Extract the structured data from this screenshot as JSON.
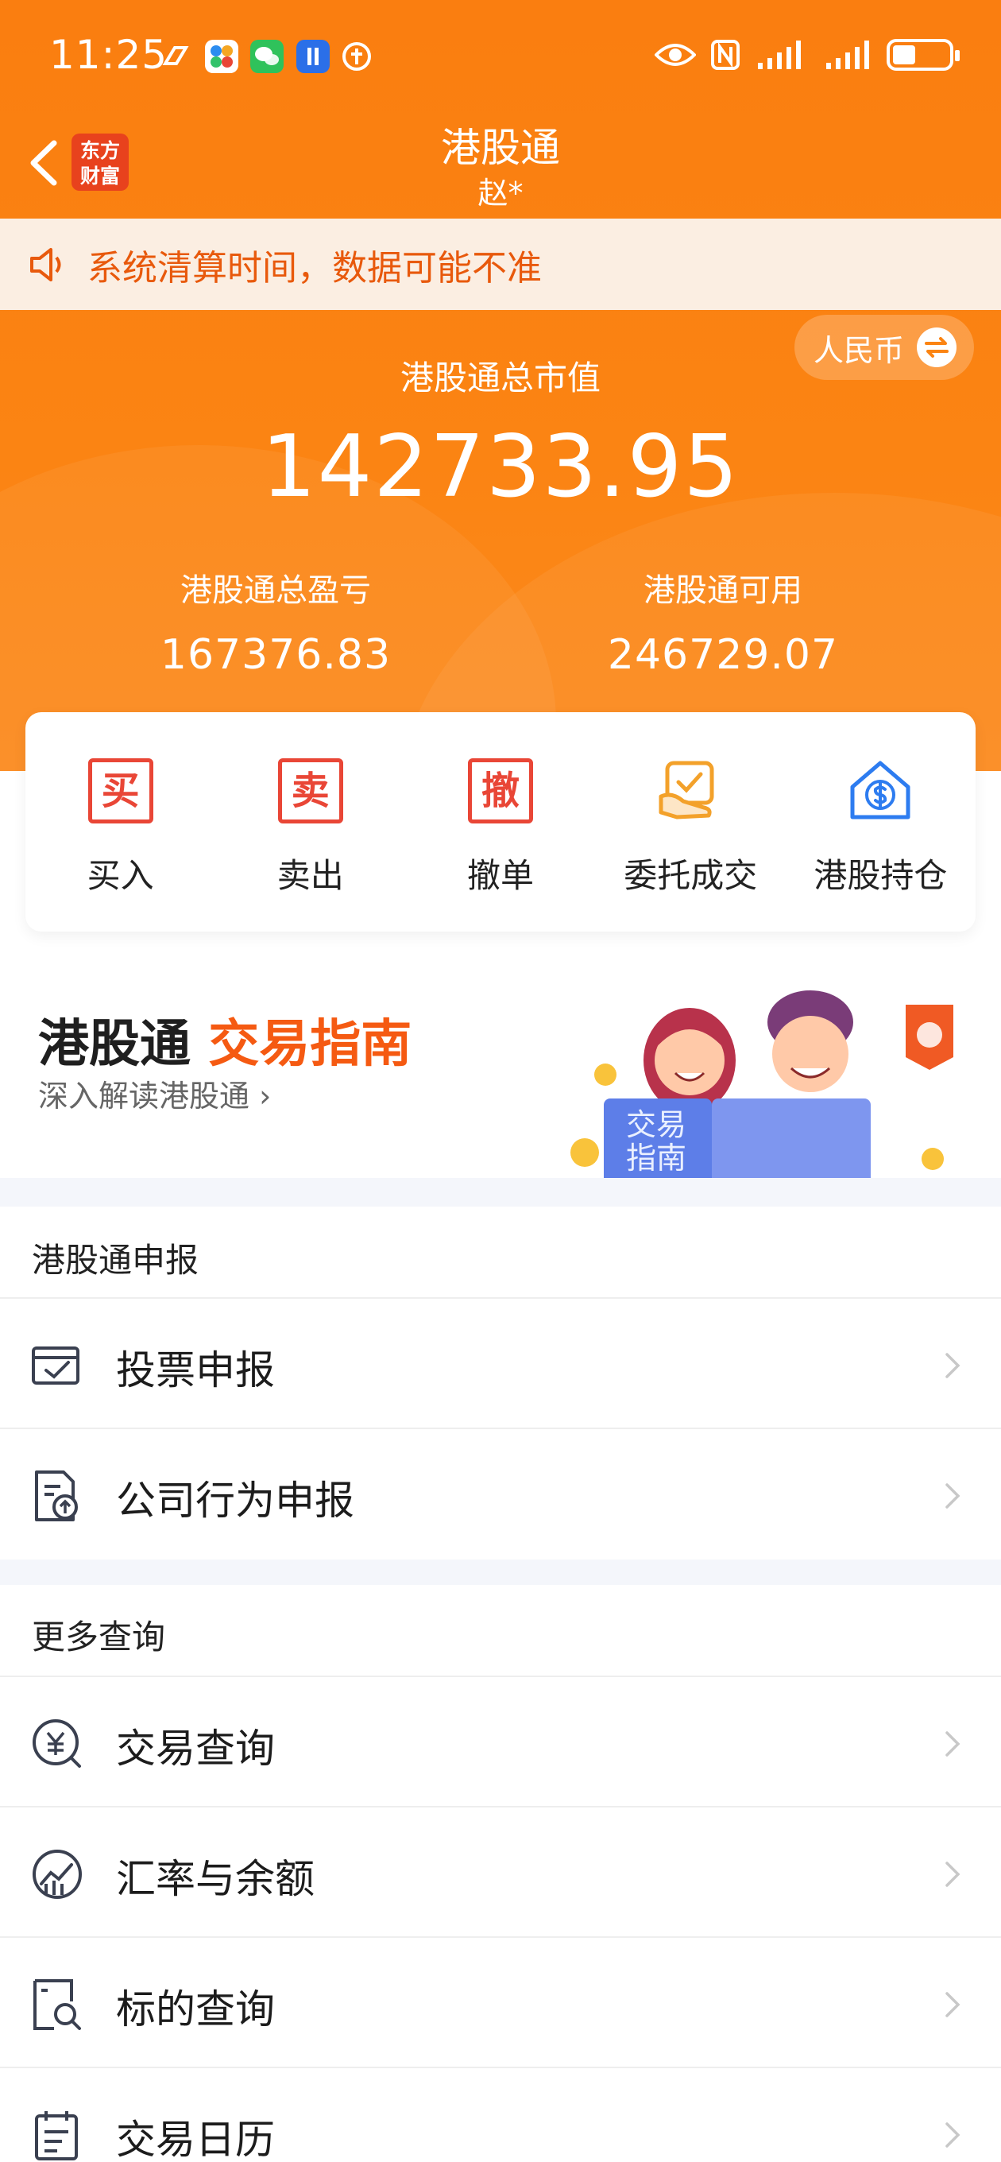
{
  "status_bar": {
    "time": "11:25"
  },
  "nav": {
    "title": "港股通",
    "subtitle": "赵*",
    "brand_line1": "东方",
    "brand_line2": "财富"
  },
  "notice": {
    "text": "系统清算时间，数据可能不准"
  },
  "currency": {
    "label": "人民币"
  },
  "summary": {
    "market_value_label": "港股通总市值",
    "market_value": "142733.95",
    "pnl_label": "港股通总盈亏",
    "pnl_value": "167376.83",
    "available_label": "港股通可用",
    "available_value": "246729.07"
  },
  "actions": [
    {
      "glyph": "买",
      "label": "买入",
      "icon": "buy-icon"
    },
    {
      "glyph": "卖",
      "label": "卖出",
      "icon": "sell-icon"
    },
    {
      "glyph": "撤",
      "label": "撤单",
      "icon": "cancel-order-icon"
    },
    {
      "glyph": "",
      "label": "委托成交",
      "icon": "orders-icon"
    },
    {
      "glyph": "",
      "label": "港股持仓",
      "icon": "holdings-icon"
    }
  ],
  "banner": {
    "title_part1": "港股通",
    "title_part2": "交易指南",
    "subtitle": "深入解读港股通",
    "book_line1": "交易",
    "book_line2": "指南"
  },
  "sections": {
    "declaration": {
      "title": "港股通申报",
      "items": [
        {
          "label": "投票申报",
          "icon": "vote-icon"
        },
        {
          "label": "公司行为申报",
          "icon": "company-action-icon"
        }
      ]
    },
    "query": {
      "title": "更多查询",
      "items": [
        {
          "label": "交易查询",
          "icon": "yuan-search-icon"
        },
        {
          "label": "汇率与余额",
          "icon": "exchange-rate-icon"
        },
        {
          "label": "标的查询",
          "icon": "target-search-icon"
        },
        {
          "label": "交易日历",
          "icon": "calendar-icon"
        }
      ]
    }
  },
  "colors": {
    "primary_orange": "#fb8413",
    "accent_red": "#e94636",
    "notice_text": "#e8590c",
    "holdings_blue": "#2d7cf0"
  }
}
